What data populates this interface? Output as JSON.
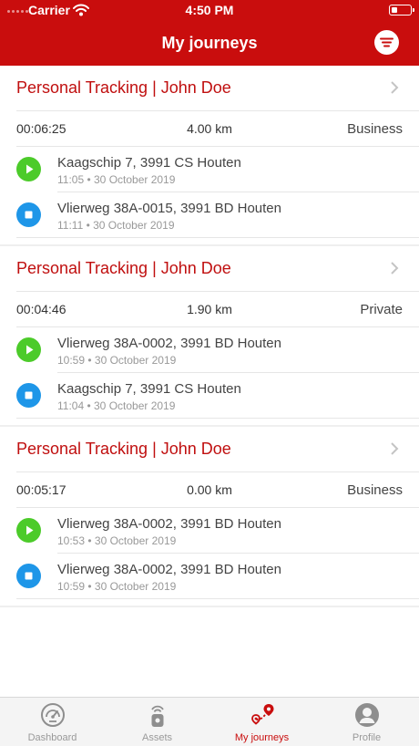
{
  "status_bar": {
    "carrier": "Carrier",
    "time": "4:50 PM"
  },
  "nav": {
    "title": "My journeys",
    "filter_icon": "filter-icon"
  },
  "colors": {
    "brand": "#c90d0d",
    "start": "#4ccb2a",
    "stop": "#1e96e8"
  },
  "journeys": [
    {
      "title": "Personal Tracking | John Doe",
      "duration": "00:06:25",
      "distance": "4.00 km",
      "purpose": "Business",
      "start": {
        "address": "Kaagschip 7, 3991 CS Houten",
        "timestamp": "11:05 • 30 October 2019"
      },
      "end": {
        "address": "Vlierweg 38A-0015, 3991 BD Houten",
        "timestamp": "11:11 • 30 October 2019"
      }
    },
    {
      "title": "Personal Tracking | John Doe",
      "duration": "00:04:46",
      "distance": "1.90 km",
      "purpose": "Private",
      "start": {
        "address": "Vlierweg 38A-0002, 3991 BD Houten",
        "timestamp": "10:59 • 30 October 2019"
      },
      "end": {
        "address": "Kaagschip 7, 3991 CS Houten",
        "timestamp": "11:04 • 30 October 2019"
      }
    },
    {
      "title": "Personal Tracking | John Doe",
      "duration": "00:05:17",
      "distance": "0.00 km",
      "purpose": "Business",
      "start": {
        "address": "Vlierweg 38A-0002, 3991 BD Houten",
        "timestamp": "10:53 • 30 October 2019"
      },
      "end": {
        "address": "Vlierweg 38A-0002, 3991 BD Houten",
        "timestamp": "10:59 • 30 October 2019"
      }
    }
  ],
  "tabs": [
    {
      "label": "Dashboard",
      "icon": "speedometer-icon",
      "active": false
    },
    {
      "label": "Assets",
      "icon": "tracker-icon",
      "active": false
    },
    {
      "label": "My journeys",
      "icon": "route-icon",
      "active": true
    },
    {
      "label": "Profile",
      "icon": "user-icon",
      "active": false
    }
  ]
}
